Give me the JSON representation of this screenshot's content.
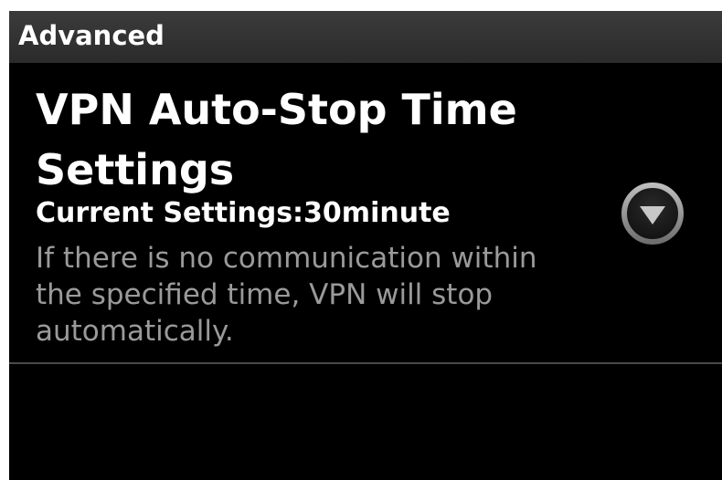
{
  "header": {
    "title": "Advanced"
  },
  "preference": {
    "title": "VPN Auto-Stop Time Settings",
    "current_settings": "Current Settings:30minute",
    "description": "If there is no communication within the specified time, VPN will stop automatically.",
    "dropdown_icon": "chevron-down-circle-icon"
  },
  "colors": {
    "background": "#000000",
    "header_background": "#333333",
    "title_text": "#ffffff",
    "description_text": "#9a9a9a",
    "divider": "#4a4a4a"
  }
}
